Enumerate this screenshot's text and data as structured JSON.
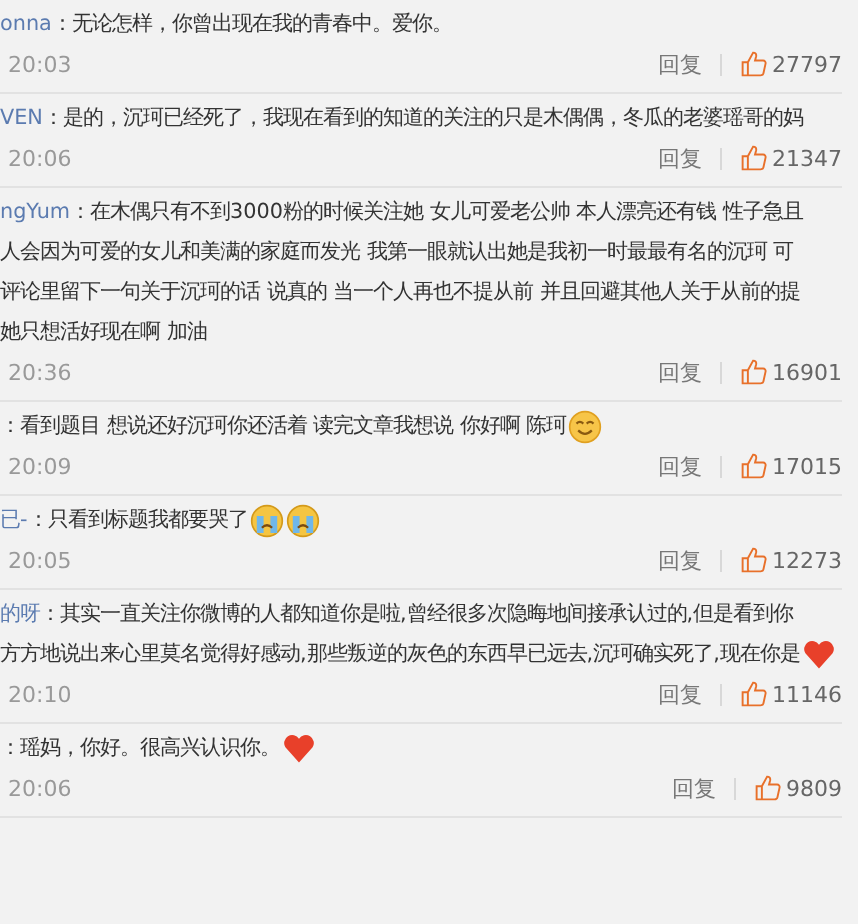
{
  "comments": [
    {
      "user": "onna",
      "lines": [
        "：无论怎样，你曾出现在我的青春中。爱你。"
      ],
      "time": "20:03",
      "reply": "回复",
      "likes": "27797"
    },
    {
      "user": "VEN",
      "lines": [
        "：是的，沉珂已经死了，我现在看到的知道的关注的只是木偶偶，冬瓜的老婆瑶哥的妈"
      ],
      "time": "20:06",
      "reply": "回复",
      "likes": "21347"
    },
    {
      "user": "ngYum",
      "lines": [
        "：在木偶只有不到3000粉的时候关注她 女儿可爱老公帅 本人漂亮还有钱 性子急且",
        "人会因为可爱的女儿和美满的家庭而发光 我第一眼就认出她是我初一时最最有名的沉珂 可",
        "评论里留下一句关于沉珂的话 说真的 当一个人再也不提从前 并且回避其他人关于从前的提",
        "她只想活好现在啊 加油"
      ],
      "time": "20:36",
      "reply": "回复",
      "likes": "16901"
    },
    {
      "lines": [
        "：看到题目 想说还好沉珂你还活着 读完文章我想说 你好啊 陈珂"
      ],
      "emojis": [
        {
          "kind": "smile"
        }
      ],
      "time": "20:09",
      "reply": "回复",
      "likes": "17015"
    },
    {
      "user": "已-",
      "lines": [
        "：只看到标题我都要哭了"
      ],
      "emojis": [
        {
          "kind": "crying"
        },
        {
          "kind": "crying"
        }
      ],
      "time": "20:05",
      "reply": "回复",
      "likes": "12273"
    },
    {
      "user": "的呀",
      "lines": [
        "：其实一直关注你微博的人都知道你是啦,曾经很多次隐晦地间接承认过的,但是看到你",
        "方方地说出来心里莫名觉得好感动,那些叛逆的灰色的东西早已远去,沉珂确实死了,现在你是"
      ],
      "emojis": [
        {
          "kind": "heart"
        }
      ],
      "time": "20:10",
      "reply": "回复",
      "likes": "11146"
    },
    {
      "lines": [
        "：瑶妈，你好。很高兴认识你。"
      ],
      "emojis": [
        {
          "kind": "heart"
        }
      ],
      "time": "20:06",
      "reply": "回复",
      "likes": "9809"
    }
  ]
}
